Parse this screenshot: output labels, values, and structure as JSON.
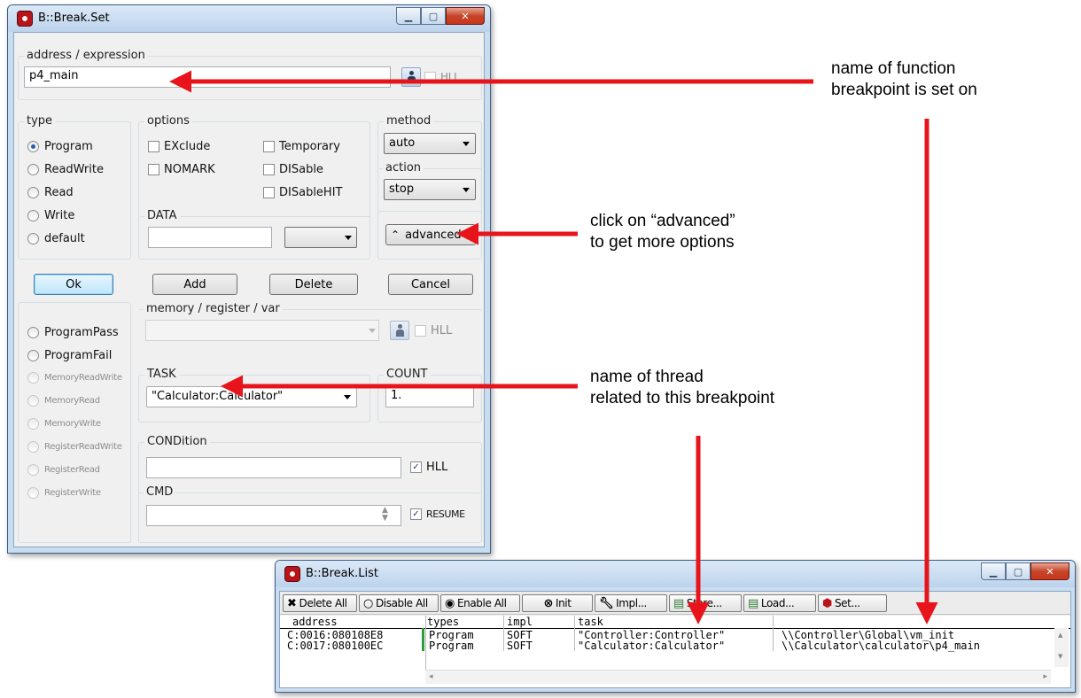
{
  "break_set": {
    "title": "B::Break.Set",
    "address_legend": "address / expression",
    "address_value": "p4_main",
    "address_hll_label": "HLL",
    "type_legend": "type",
    "type_options": [
      "Program",
      "ReadWrite",
      "Read",
      "Write",
      "default"
    ],
    "type_selected": "Program",
    "options_legend": "options",
    "options": [
      "EXclude",
      "NOMARK",
      "Temporary",
      "DISable",
      "DISableHIT"
    ],
    "method_legend": "method",
    "method_value": "auto",
    "action_legend": "action",
    "action_value": "stop",
    "data_legend": "DATA",
    "data_value": "",
    "data_combo_value": "",
    "advanced_label": "advanced",
    "ok_label": "Ok",
    "add_label": "Add",
    "delete_label": "Delete",
    "cancel_label": "Cancel",
    "mem_reg_legend": "memory / register / var",
    "mem_reg_value": "",
    "mem_reg_hll_label": "HLL",
    "program_pass": "ProgramPass",
    "program_fail": "ProgramFail",
    "dim_options": [
      "MemoryReadWrite",
      "MemoryRead",
      "MemoryWrite",
      "RegisterReadWrite",
      "RegisterRead",
      "RegisterWrite"
    ],
    "task_legend": "TASK",
    "task_value": "\"Calculator:Calculator\"",
    "count_legend": "COUNT",
    "count_value": "1.",
    "condition_legend": "CONDition",
    "condition_value": "",
    "condition_hll_label": "HLL",
    "cmd_legend": "CMD",
    "cmd_value": "",
    "resume_label": "RESUME"
  },
  "break_list": {
    "title": "B::Break.List",
    "toolbar": {
      "delete_all": "Delete All",
      "disable_all": "Disable All",
      "enable_all": "Enable All",
      "init": "Init",
      "impl": "Impl...",
      "store": "Store...",
      "load": "Load...",
      "set": "Set..."
    },
    "columns": [
      "address",
      "types",
      "impl",
      "task"
    ],
    "rows": [
      {
        "address": "C:0016:080108E8",
        "types": "Program",
        "impl": "SOFT",
        "task": "\"Controller:Controller\"",
        "location": "\\\\Controller\\Global\\vm_init"
      },
      {
        "address": "C:0017:080100EC",
        "types": "Program",
        "impl": "SOFT",
        "task": "\"Calculator:Calculator\"",
        "location": "\\\\Calculator\\calculator\\p4_main"
      }
    ]
  },
  "annotations": {
    "function_note_line1": "name of function",
    "function_note_line2": "breakpoint is set on",
    "advanced_note_line1": "click on “advanced”",
    "advanced_note_line2": "to get more options",
    "thread_note_line1": "name of thread",
    "thread_note_line2": "related to this breakpoint"
  },
  "colors": {
    "arrow": "#e8141b",
    "window_frame": "#c9ddf1",
    "client_bg": "#f0f0f0"
  }
}
